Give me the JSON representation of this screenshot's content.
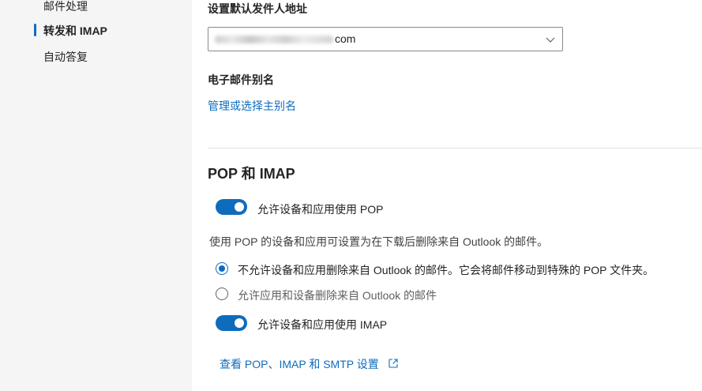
{
  "sidebar": {
    "items": [
      {
        "label": "邮件处理",
        "active": false
      },
      {
        "label": "转发和 IMAP",
        "active": true
      },
      {
        "label": "自动答复",
        "active": false
      }
    ]
  },
  "default_from": {
    "heading": "设置默认发件人地址",
    "value_suffix": "com"
  },
  "aliases": {
    "heading": "电子邮件别名",
    "manage_link": "管理或选择主别名"
  },
  "pop_imap": {
    "title": "POP 和 IMAP",
    "pop_toggle": {
      "label": "允许设备和应用使用 POP",
      "on": true
    },
    "description": "使用 POP 的设备和应用可设置为在下载后删除来自 Outlook 的邮件。",
    "radio_options": [
      {
        "label": "不允许设备和应用删除来自 Outlook 的邮件。它会将邮件移动到特殊的 POP 文件夹。",
        "checked": true
      },
      {
        "label": "允许应用和设备删除来自 Outlook 的邮件",
        "checked": false
      }
    ],
    "imap_toggle": {
      "label": "允许设备和应用使用 IMAP",
      "on": true
    },
    "settings_link": "查看 POP、IMAP 和 SMTP 设置"
  },
  "colors": {
    "accent": "#0f6cbd",
    "sidebar_bg": "#f5f5f5"
  },
  "icons": [
    "chevron-down-icon",
    "open-external-icon"
  ]
}
